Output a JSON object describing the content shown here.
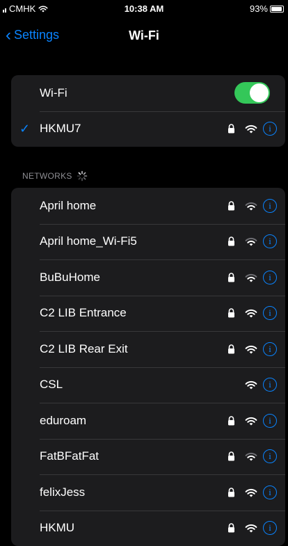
{
  "status_bar": {
    "carrier": "CMHK",
    "time": "10:38 AM",
    "battery": "93%"
  },
  "nav": {
    "back_label": "Settings",
    "title": "Wi-Fi"
  },
  "wifi_toggle": {
    "label": "Wi-Fi",
    "on": true,
    "accent": "#34c759"
  },
  "connected": {
    "name": "HKMU7",
    "secured": true
  },
  "section_header": "NETWORKS",
  "networks": [
    {
      "name": "April home",
      "secured": true,
      "signal": 2
    },
    {
      "name": "April home_Wi-Fi5",
      "secured": true,
      "signal": 2
    },
    {
      "name": "BuBuHome",
      "secured": true,
      "signal": 2
    },
    {
      "name": "C2 LIB Entrance",
      "secured": true,
      "signal": 3
    },
    {
      "name": "C2 LIB Rear Exit",
      "secured": true,
      "signal": 3
    },
    {
      "name": "CSL",
      "secured": false,
      "signal": 3
    },
    {
      "name": "eduroam",
      "secured": true,
      "signal": 3
    },
    {
      "name": "FatBFatFat",
      "secured": true,
      "signal": 2
    },
    {
      "name": "felixJess",
      "secured": true,
      "signal": 3
    },
    {
      "name": "HKMU",
      "secured": true,
      "signal": 3
    }
  ],
  "colors": {
    "accent": "#0a84ff",
    "background": "#000000",
    "group": "#1c1c1e"
  }
}
